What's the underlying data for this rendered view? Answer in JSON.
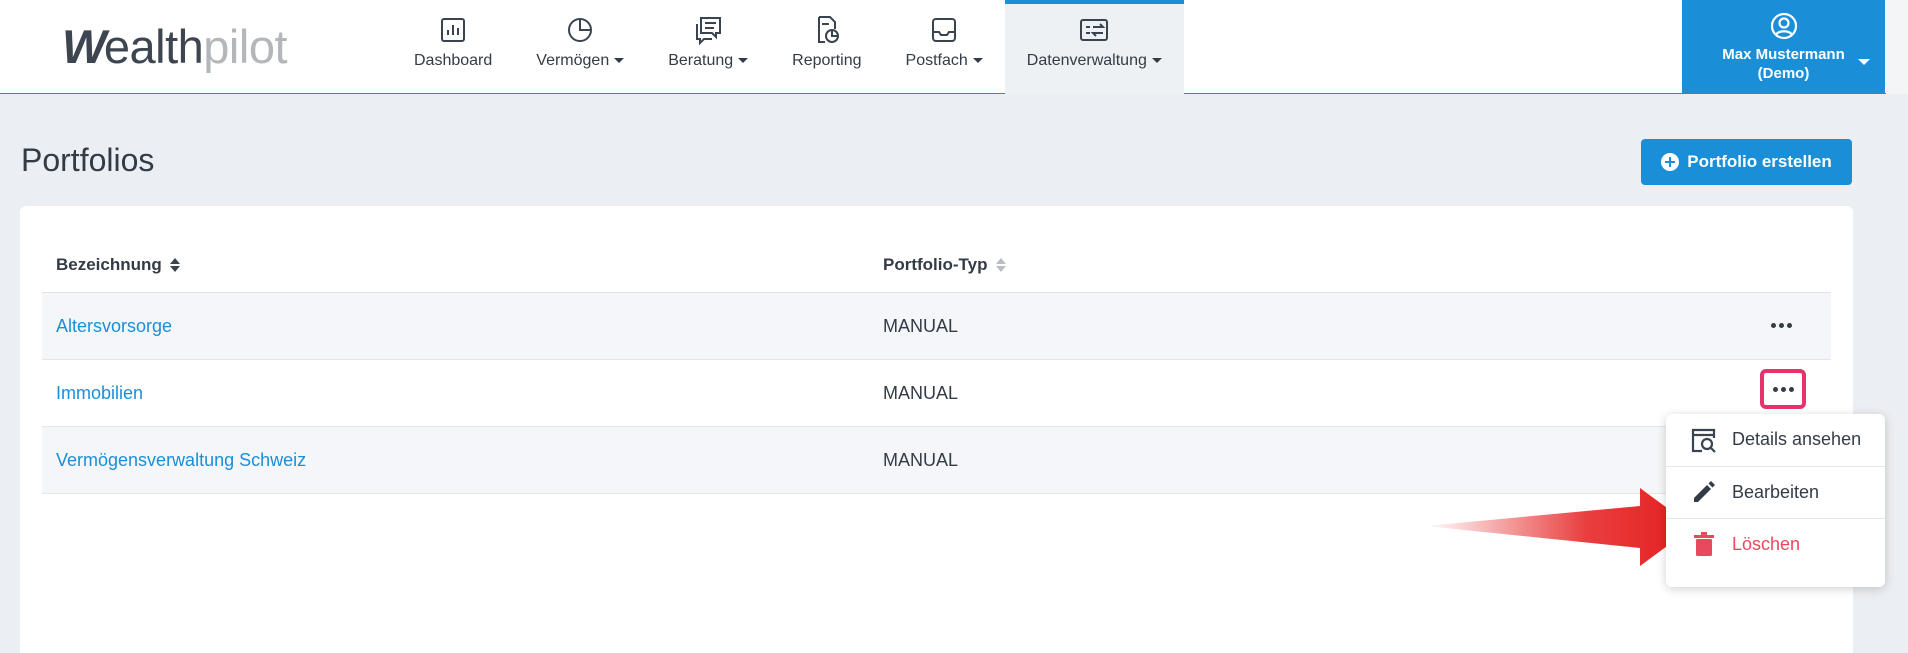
{
  "brand": {
    "logo_mark": "W",
    "logo_part1": "ealth",
    "logo_part2": "pilot"
  },
  "nav": [
    {
      "label": "Dashboard",
      "icon": "chart-bar-icon",
      "dropdown": false
    },
    {
      "label": "Vermögen",
      "icon": "pie-chart-icon",
      "dropdown": true
    },
    {
      "label": "Beratung",
      "icon": "chat-icon",
      "dropdown": true
    },
    {
      "label": "Reporting",
      "icon": "report-icon",
      "dropdown": false
    },
    {
      "label": "Postfach",
      "icon": "inbox-icon",
      "dropdown": true
    },
    {
      "label": "Datenverwaltung",
      "icon": "data-transfer-icon",
      "dropdown": true,
      "active": true
    }
  ],
  "user": {
    "name": "Max Mustermann (Demo)",
    "icon": "user-circle-icon"
  },
  "page": {
    "title": "Portfolios",
    "create_button": "Portfolio erstellen"
  },
  "table": {
    "columns": [
      "Bezeichnung",
      "Portfolio-Typ"
    ],
    "rows": [
      {
        "name": "Altersvorsorge",
        "type": "MANUAL"
      },
      {
        "name": "Immobilien",
        "type": "MANUAL"
      },
      {
        "name": "Vermögensverwaltung Schweiz",
        "type": "MANUAL"
      }
    ]
  },
  "menu": {
    "items": [
      {
        "label": "Details ansehen",
        "icon": "details-search-icon"
      },
      {
        "label": "Bearbeiten",
        "icon": "pencil-icon"
      },
      {
        "label": "Löschen",
        "icon": "trash-icon"
      }
    ]
  },
  "colors": {
    "accent": "#1a8fd8",
    "danger": "#e8495c",
    "highlight": "#e6336b",
    "arrow": "#e51d1d"
  }
}
